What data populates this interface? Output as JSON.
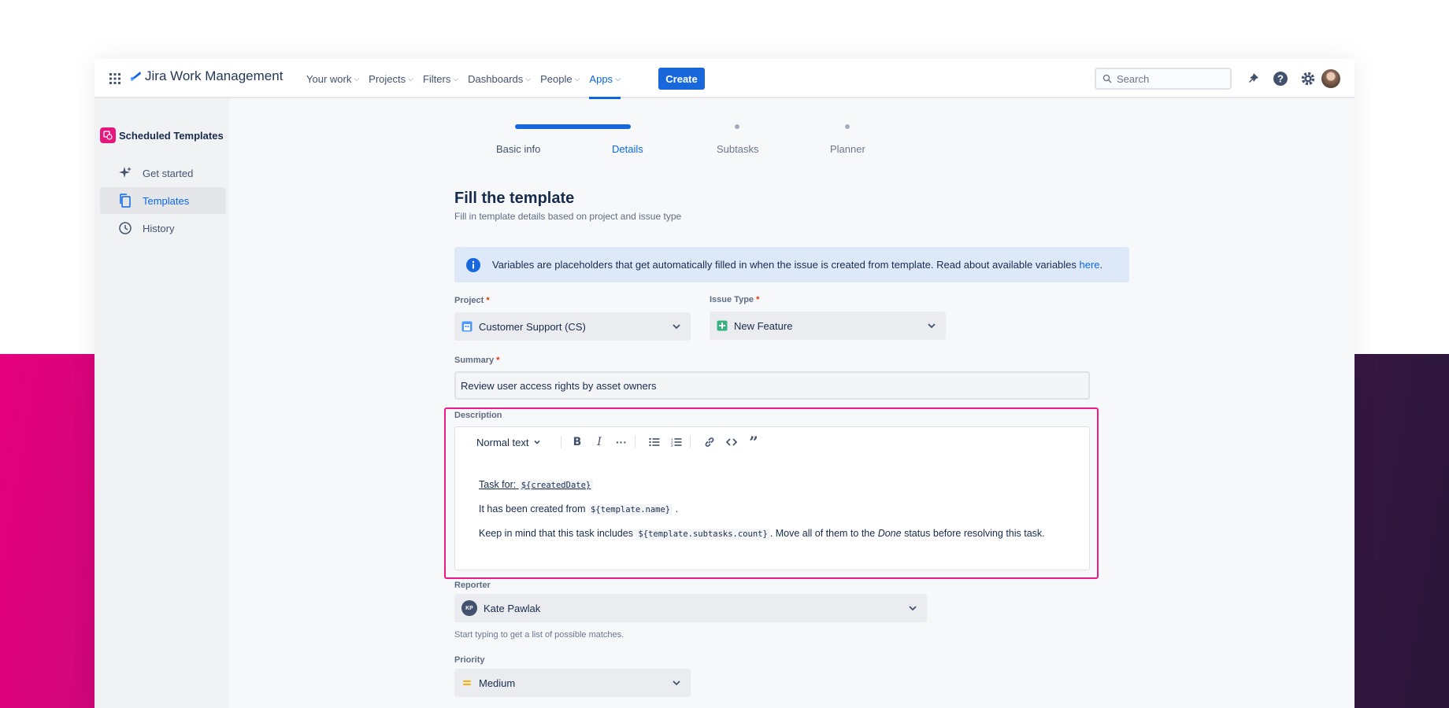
{
  "nav": {
    "app_name": "Jira Work Management",
    "items": [
      {
        "label": "Your work"
      },
      {
        "label": "Projects"
      },
      {
        "label": "Filters"
      },
      {
        "label": "Dashboards"
      },
      {
        "label": "People"
      },
      {
        "label": "Apps"
      }
    ],
    "active_item": "Apps",
    "create_label": "Create",
    "search_placeholder": "Search"
  },
  "sidebar": {
    "title": "Scheduled Templates",
    "items": [
      {
        "label": "Get started",
        "icon": "sparkle-icon"
      },
      {
        "label": "Templates",
        "icon": "copy-icon"
      },
      {
        "label": "History",
        "icon": "clock-icon"
      }
    ],
    "active_item": "Templates"
  },
  "stepper": {
    "steps": [
      "Basic info",
      "Details",
      "Subtasks",
      "Planner"
    ],
    "current": "Details"
  },
  "page": {
    "title": "Fill the template",
    "subtitle": "Fill in template details based on project and issue type"
  },
  "banner": {
    "text": "Variables are placeholders that get automatically filled in when the issue is created from template. Read about available variables ",
    "link": "here",
    "suffix": "."
  },
  "form": {
    "project": {
      "label": "Project",
      "value": "Customer Support (CS)"
    },
    "issue_type": {
      "label": "Issue Type",
      "value": "New Feature"
    },
    "summary": {
      "label": "Summary",
      "value": "Review user access rights by asset owners"
    },
    "description": {
      "label": "Description",
      "text_style": "Normal text",
      "line1_prefix": "Task for:",
      "line1_code": "${createdDate}",
      "line2_prefix": "It has been created from",
      "line2_code": "${template.name}",
      "line2_suffix": ".",
      "line3_prefix": "Keep in mind that this task includes",
      "line3_code": "${template.subtasks.count}",
      "line3_mid": ". Move all of them to the",
      "line3_italic": "Done",
      "line3_suffix": "status before resolving this task."
    },
    "reporter": {
      "label": "Reporter",
      "value": "Kate Pawlak",
      "initials": "KP",
      "hint": "Start typing to get a list of possible matches."
    },
    "priority": {
      "label": "Priority",
      "value": "Medium"
    }
  },
  "colors": {
    "accent": "#0c66e4",
    "highlight": "#ee1a8a",
    "brand_badge": "#e5177f"
  }
}
